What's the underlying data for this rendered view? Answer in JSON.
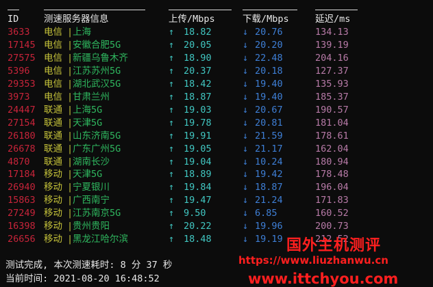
{
  "header": {
    "id": "ID",
    "server": "测速服务器信息",
    "upload": "上传/Mbps",
    "download": "下载/Mbps",
    "latency": "延迟/ms"
  },
  "colors": {
    "id": "#c8243a",
    "isp": "#c6c33a",
    "city": "#2fb85f",
    "upload": "#41c7c2",
    "download": "#3e7fd6",
    "latency": "#b87ba8",
    "watermark": "#ff1f1f"
  },
  "arrows": {
    "up": "↑",
    "down": "↓"
  },
  "separator": "|",
  "rows": [
    {
      "id": "3633",
      "isp": "电信",
      "city": "上海",
      "up": "18.82",
      "down": "20.76",
      "lat": "134.13"
    },
    {
      "id": "17145",
      "isp": "电信",
      "city": "安徽合肥5G",
      "up": "20.05",
      "down": "20.20",
      "lat": "139.19"
    },
    {
      "id": "27575",
      "isp": "电信",
      "city": "新疆乌鲁木齐",
      "up": "18.90",
      "down": "22.48",
      "lat": "204.16"
    },
    {
      "id": "5396",
      "isp": "电信",
      "city": "江苏苏州5G",
      "up": "20.37",
      "down": "20.18",
      "lat": "127.37"
    },
    {
      "id": "29353",
      "isp": "电信",
      "city": "湖北武汉5G",
      "up": "18.42",
      "down": "19.40",
      "lat": "135.93"
    },
    {
      "id": "3973",
      "isp": "电信",
      "city": "甘肃兰州",
      "up": "18.87",
      "down": "19.40",
      "lat": "185.37"
    },
    {
      "id": "24447",
      "isp": "联通",
      "city": "上海5G",
      "up": "19.03",
      "down": "20.67",
      "lat": "190.57"
    },
    {
      "id": "27154",
      "isp": "联通",
      "city": "天津5G",
      "up": "19.78",
      "down": "20.81",
      "lat": "181.04"
    },
    {
      "id": "26180",
      "isp": "联通",
      "city": "山东济南5G",
      "up": "19.91",
      "down": "21.59",
      "lat": "178.61"
    },
    {
      "id": "26678",
      "isp": "联通",
      "city": "广东广州5G",
      "up": "19.05",
      "down": "21.17",
      "lat": "162.04"
    },
    {
      "id": "4870",
      "isp": "联通",
      "city": "湖南长沙",
      "up": "19.04",
      "down": "10.24",
      "lat": "180.94"
    },
    {
      "id": "17184",
      "isp": "移动",
      "city": "天津5G",
      "up": "18.89",
      "down": "19.42",
      "lat": "178.48"
    },
    {
      "id": "26940",
      "isp": "移动",
      "city": "宁夏银川",
      "up": "19.84",
      "down": "18.87",
      "lat": "196.04"
    },
    {
      "id": "15863",
      "isp": "移动",
      "city": "广西南宁",
      "up": "19.47",
      "down": "21.24",
      "lat": "171.83"
    },
    {
      "id": "27249",
      "isp": "移动",
      "city": "江苏南京5G",
      "up": "9.50",
      "down": "6.85",
      "lat": "160.52"
    },
    {
      "id": "16398",
      "isp": "移动",
      "city": "贵州贵阳",
      "up": "20.22",
      "down": "19.96",
      "lat": "200.73"
    },
    {
      "id": "26656",
      "isp": "移动",
      "city": "黑龙江哈尔滨",
      "up": "18.48",
      "down": "19.19",
      "lat": "212.52"
    }
  ],
  "footer": {
    "completed": " 测试完成, 本次测速耗时: 8 分 37 秒",
    "current_time": " 当前时间: 2021-08-20 16:48:52"
  },
  "watermark": {
    "title": "国外主机测评",
    "url": "https://www.liuzhanwu.cn",
    "url2": "www.ittchyou.com"
  }
}
